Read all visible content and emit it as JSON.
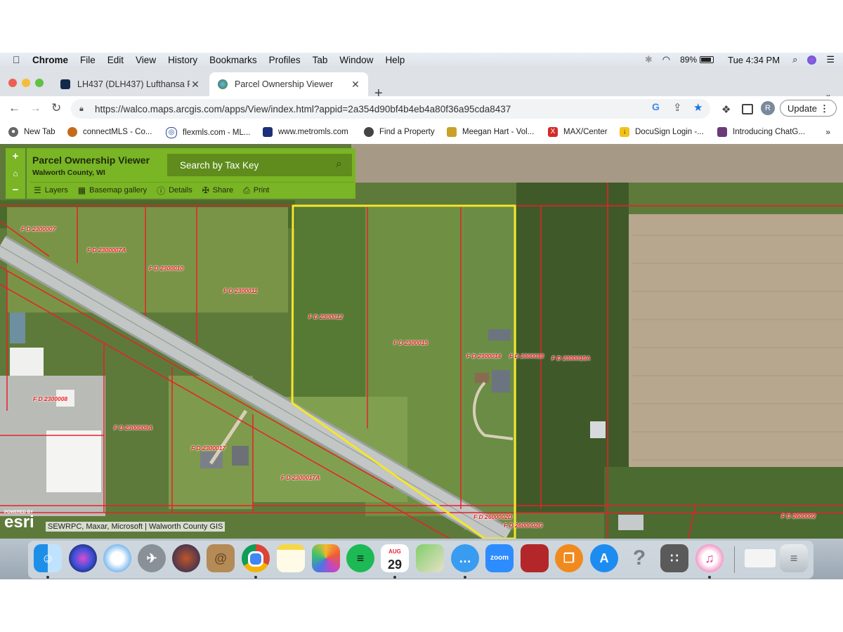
{
  "menubar": {
    "app_name": "Chrome",
    "items": [
      "File",
      "Edit",
      "View",
      "History",
      "Bookmarks",
      "Profiles",
      "Tab",
      "Window",
      "Help"
    ],
    "battery": "89%",
    "clock": "Tue 4:34 PM"
  },
  "tabs": [
    {
      "title": "LH437 (DLH437) Lufthansa Fli",
      "active": false
    },
    {
      "title": "Parcel Ownership Viewer",
      "active": true
    }
  ],
  "toolbar": {
    "url": "https://walco.maps.arcgis.com/apps/View/index.html?appid=2a354d90bf4b4eb4a80f36a95cda8437",
    "avatar_letter": "R",
    "update_label": "Update"
  },
  "bookmarks": [
    {
      "label": "New Tab",
      "icon": "newtab-icon"
    },
    {
      "label": "connectMLS - Co...",
      "icon": "connectmls-icon"
    },
    {
      "label": "flexmls.com - ML...",
      "icon": "flexmls-icon"
    },
    {
      "label": "www.metromls.com",
      "icon": "metromls-icon"
    },
    {
      "label": "Find a Property",
      "icon": "globe-icon"
    },
    {
      "label": "Meegan Hart - Vol...",
      "icon": "buffalo-icon"
    },
    {
      "label": "MAX/Center",
      "icon": "max-icon"
    },
    {
      "label": "DocuSign Login -...",
      "icon": "docusign-icon"
    },
    {
      "label": "Introducing ChatG...",
      "icon": "chatgpt-icon"
    }
  ],
  "viewer": {
    "title": "Parcel Ownership Viewer",
    "subtitle": "Walworth County, WI",
    "search_placeholder": "Search by Tax Key",
    "tools": [
      "Layers",
      "Basemap gallery",
      "Details",
      "Share",
      "Print"
    ],
    "zoom_in": "+",
    "home": "⌂",
    "zoom_out": "−",
    "attribution": "SEWRPC, Maxar, Microsoft | Walworth County GIS",
    "esri_powered": "POWERED BY",
    "esri_logo": "esri"
  },
  "parcels": [
    "F D 2300007",
    "F D 2300007A",
    "F D 2300010",
    "F D 2300011",
    "F D 2300012",
    "F D 2300015",
    "F D 2300014",
    "F D 2300013",
    "F D 2300015A",
    "F D 2300008",
    "F D 2300009A",
    "F D 2300017",
    "F D 2300017A",
    "F D 2600002",
    "F D 2600002D",
    "F D 2600002G"
  ],
  "dock": {
    "calendar_month": "AUG",
    "calendar_day": "29",
    "zoom_label": "zoom",
    "apps": [
      "Finder",
      "Siri",
      "Safari",
      "Launchpad",
      "Photo Booth",
      "Contacts",
      "Chrome",
      "Notes",
      "Photos",
      "Spotify",
      "Calendar",
      "Maps",
      "Messages",
      "Zoom",
      "Photo Booth 2",
      "Books",
      "App Store",
      "Help",
      "Calculator",
      "iTunes",
      "Downloads",
      "Trash"
    ]
  },
  "colors": {
    "panel_green": "#79b524",
    "search_green": "#5f8c1c",
    "parcel_line": "#e8202a",
    "selected_parcel": "#f5e62a"
  }
}
